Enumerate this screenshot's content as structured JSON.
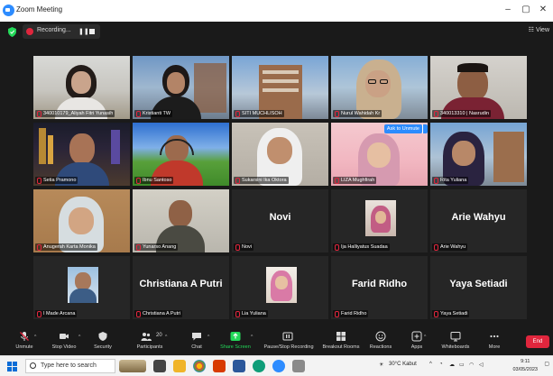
{
  "window": {
    "title": "Zoom Meeting",
    "controls": {
      "minimize": "–",
      "maximize": "▢",
      "close": "✕"
    }
  },
  "topbar": {
    "recording_label": "Recording...",
    "pause_glyph": "❚❚",
    "view_label": "View"
  },
  "participants": [
    {
      "name": "340010179_Aliyah Fitri Yunasih",
      "big": ""
    },
    {
      "name": "Kristianti TW",
      "big": ""
    },
    {
      "name": "SITI MUCHLISOH",
      "big": ""
    },
    {
      "name": "Nurul Wahidah Kr",
      "big": ""
    },
    {
      "name": "340013310 | Nasrudin",
      "big": ""
    },
    {
      "name": "Setia Pramono",
      "big": ""
    },
    {
      "name": "Ibnu Santoso",
      "big": ""
    },
    {
      "name": "Sukarsini Ika Oktora",
      "big": ""
    },
    {
      "name": "LIZA Mughfirah",
      "big": "",
      "unmute_label": "Ask to Unmute"
    },
    {
      "name": "Rita Yuliana",
      "big": ""
    },
    {
      "name": "Anugerah Karta Monika",
      "big": ""
    },
    {
      "name": "Yunarso Anang",
      "big": ""
    },
    {
      "name": "Novi",
      "big": "Novi"
    },
    {
      "name": "Ija Halliyatus Suadaa",
      "big": ""
    },
    {
      "name": "Arie Wahyu",
      "big": "Arie Wahyu"
    },
    {
      "name": "I Made Arcana",
      "big": ""
    },
    {
      "name": "Christiana A Putri",
      "big": "Christiana A Putri"
    },
    {
      "name": "Lia Yuliana",
      "big": ""
    },
    {
      "name": "Farid Ridho",
      "big": "Farid Ridho"
    },
    {
      "name": "Yaya Setiadi",
      "big": "Yaya Setiadi"
    }
  ],
  "toolbar": {
    "unmute": "Unmute",
    "stop_video": "Stop Video",
    "security": "Security",
    "participants": "Participants",
    "participants_count": "20",
    "chat": "Chat",
    "share_screen": "Share Screen",
    "pause_recording": "Pause/Stop Recording",
    "breakout_rooms": "Breakout Rooms",
    "reactions": "Reactions",
    "apps": "Apps",
    "whiteboards": "Whiteboards",
    "more": "More",
    "end": "End"
  },
  "taskbar": {
    "search_placeholder": "Type here to search",
    "weather": "30°C Kabut",
    "time": "9:11",
    "date": "03/05/2023"
  },
  "colors": {
    "zoom_blue": "#2d8cff",
    "end_red": "#e0263d",
    "share_green": "#23d959",
    "speaker_outline": "#d8e43a"
  }
}
